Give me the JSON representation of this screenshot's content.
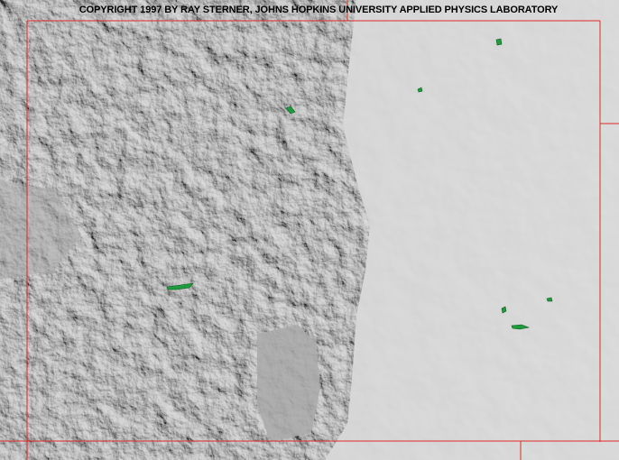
{
  "map": {
    "copyright": "COPYRIGHT 1997 BY RAY STERNER, JOHNS HOPKINS UNIVERSITY APPLIED PHYSICS LABORATORY",
    "style": "shaded-relief",
    "colors": {
      "terrain_light": "#c9c9c9",
      "terrain_mid": "#a8a8a8",
      "terrain_dark": "#3a3a3a",
      "border": "#e0282a",
      "water": "#1f9a3c",
      "text": "#000000"
    }
  }
}
